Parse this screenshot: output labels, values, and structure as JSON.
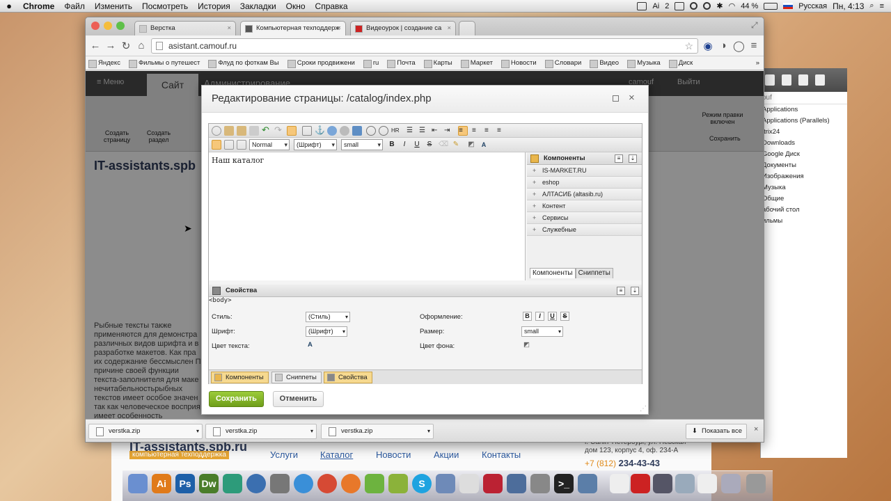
{
  "menubar": {
    "app": "Chrome",
    "items": [
      "Файл",
      "Изменить",
      "Посмотреть",
      "История",
      "Закладки",
      "Окно",
      "Справка"
    ],
    "ai_count": "2",
    "battery": "44 %",
    "language": "Русская",
    "clock": "Пн, 4:13"
  },
  "finder": {
    "crumb": "ouf",
    "items": [
      "Applications",
      "Applications (Parallels)",
      "itrix24",
      "Downloads",
      "Google Диск",
      "Документы",
      "Изображения",
      "Музыка",
      "Общие",
      "абочий стол",
      "ильмы"
    ]
  },
  "browser": {
    "tabs": [
      "Верстка",
      "Компьютерная техподдерж",
      "Видеоурок | создание са"
    ],
    "url": "asistant.camouf.ru",
    "bookmarks": [
      "Яндекс",
      "Фильмы о путешест",
      "Флуд по фоткам Вы",
      "Сроки продвижени",
      "ru",
      "Почта",
      "Карты",
      "Маркет",
      "Новости",
      "Словари",
      "Видео",
      "Музыка",
      "Диск"
    ]
  },
  "admin": {
    "menu": "Меню",
    "tab_site": "Сайт",
    "tab_admin": "Администрирование",
    "user": "camouf",
    "logout": "Выйти",
    "btn_create_page": "Создать страницу",
    "btn_create_section": "Создать раздел",
    "edit_mode": "Режим правки включен",
    "save_label": "Сохранить"
  },
  "page_bg": {
    "logo": "IT-assistants.spb",
    "text": "Рыбные тексты также применяются для демонстра различных видов шрифта и в разработке макетов. Как пра их содержание бессмыслен По причине своей функции текста-заполнителя для маке нечитабельностьрыбных текстов имеет особое значен так как человеческое восприя имеет особенность"
  },
  "dialog": {
    "title": "Редактирование страницы: /catalog/index.php",
    "style_value": "Normal",
    "font_value": "(Шрифт)",
    "size_value": "small",
    "content_text": "Наш каталог",
    "components_title": "Компоненты",
    "components": [
      "IS-MARKET.RU",
      "eshop",
      "АЛТАСИБ (altasib.ru)",
      "Контент",
      "Сервисы",
      "Служебные"
    ],
    "comp_tab_components": "Компоненты",
    "comp_tab_snippets": "Сниппеты",
    "properties_title": "Свойства",
    "body_tag": "<body>",
    "label_style": "Стиль:",
    "label_font": "Шрифт:",
    "label_text_color": "Цвет текста:",
    "label_design": "Оформление:",
    "label_size": "Размер:",
    "label_bg_color": "Цвет фона:",
    "prop_style_value": "(Стиль)",
    "prop_font_value": "(Шрифт)",
    "prop_size_value": "small",
    "bottom_tab_components": "Компоненты",
    "bottom_tab_snippets": "Сниппеты",
    "bottom_tab_properties": "Свойства",
    "save": "Сохранить",
    "cancel": "Отменить"
  },
  "downloads": {
    "files": [
      "verstka.zip",
      "verstka.zip",
      "verstka.zip"
    ],
    "show_all": "Показать все"
  },
  "site": {
    "logo": "IT-assistants.spb.ru",
    "subtitle": "компьютерная техподдержка",
    "nav": [
      "Услуги",
      "Каталог",
      "Новости",
      "Акции",
      "Контакты"
    ],
    "address1": "г. Санкт-Петербург, ул. Невская",
    "address2": "дом 123, корпус 4, оф. 234-А",
    "phone_prefix": "+7 (812)",
    "phone": "234-43-43"
  },
  "colors": {
    "save_green": "#7fae22",
    "accent_orange": "#e6a534",
    "link_blue": "#2c5aa0"
  }
}
